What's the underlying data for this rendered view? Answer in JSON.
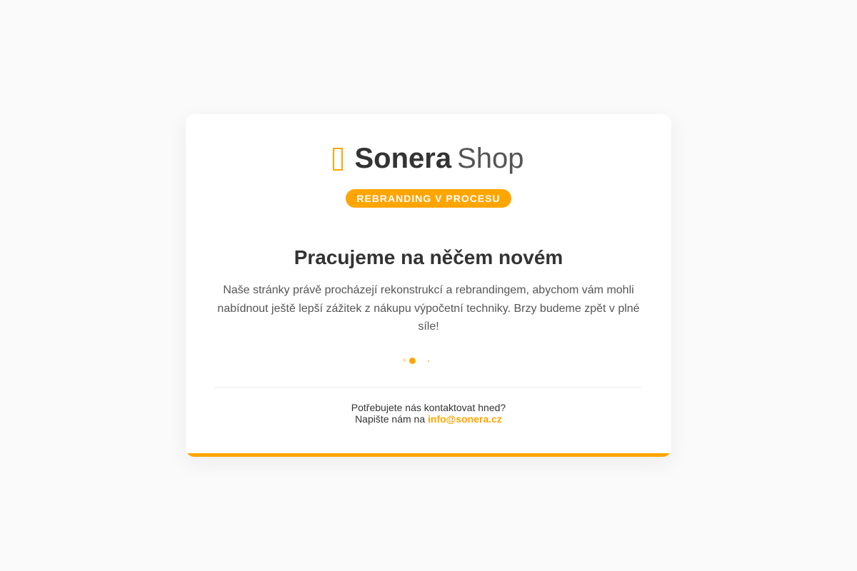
{
  "brand": {
    "name": "Sonera",
    "suffix": "Shop",
    "icon": "store-icon",
    "accent_color": "#ffa500"
  },
  "badge": {
    "label": "REBRANDING V PROCESU"
  },
  "main": {
    "heading": "Pracujeme na něčem novém",
    "description": "Naše stránky právě procházejí rekonstrukcí a rebrandingem, abychom vám mohli nabídnout ještě lepší zážitek z nákupu výpočetní techniky. Brzy budeme zpět v plné síle!"
  },
  "contact": {
    "question": "Potřebujete nás kontaktovat hned?",
    "prompt": "Napište nám na",
    "email": "info@sonera.cz"
  }
}
